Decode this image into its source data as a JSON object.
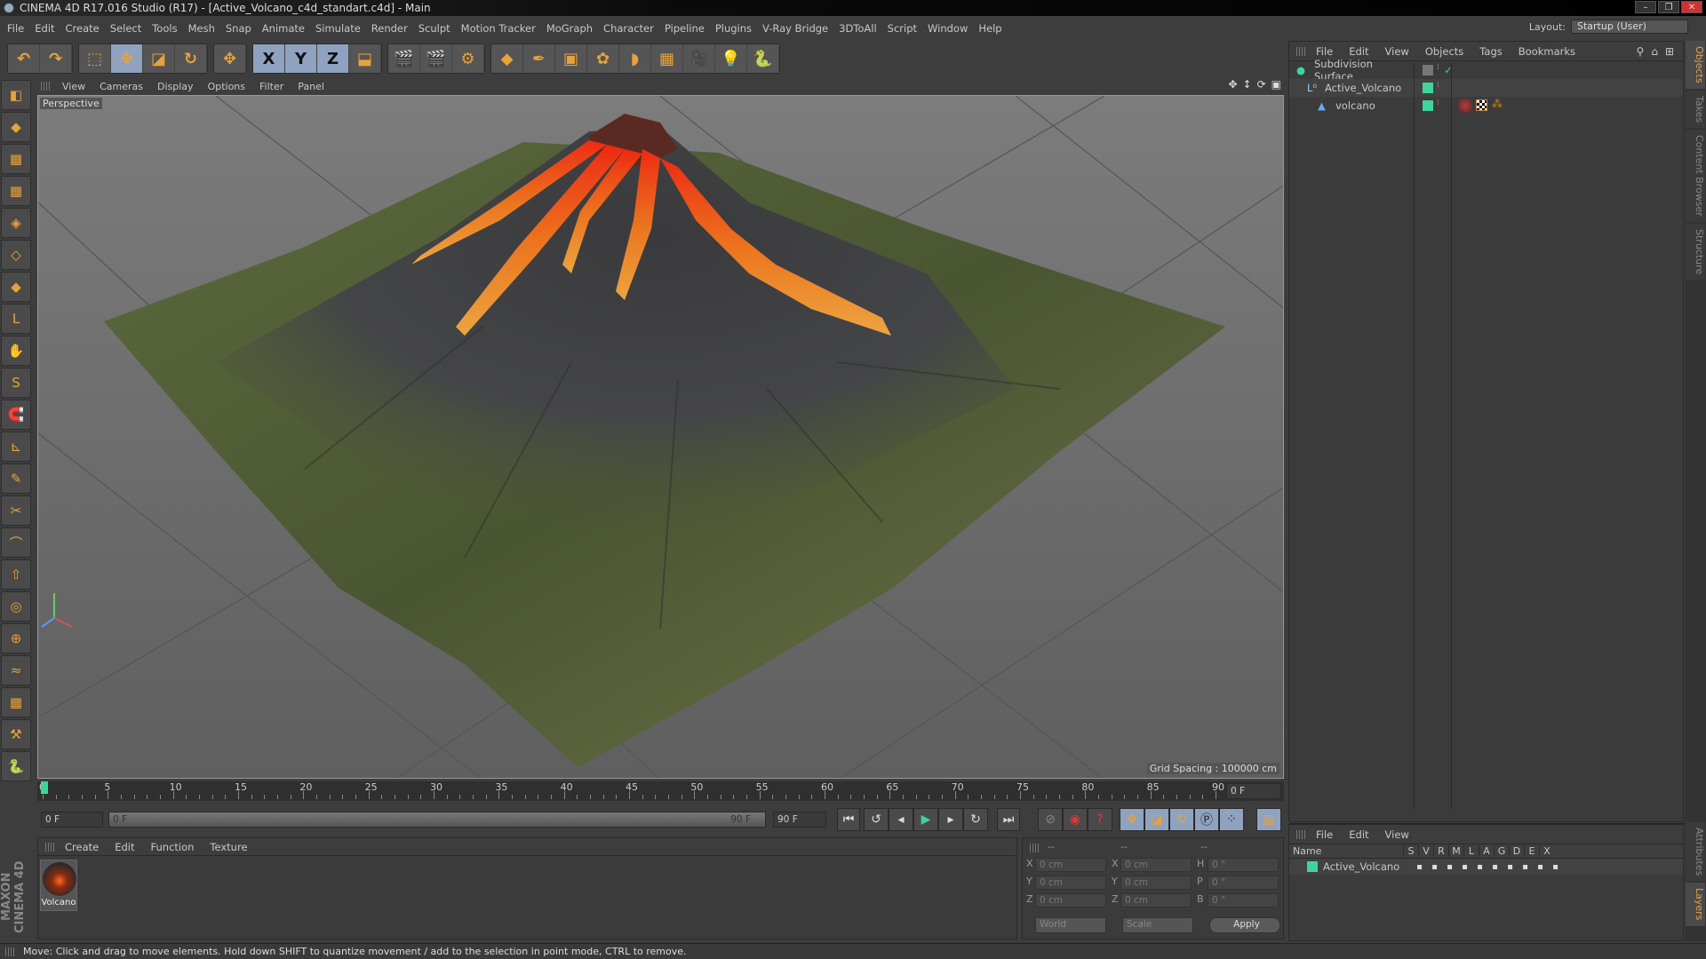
{
  "window": {
    "title": "CINEMA 4D R17.016 Studio (R17) - [Active_Volcano_c4d_standart.c4d] - Main",
    "buttons": [
      "–",
      "❐",
      "✕"
    ]
  },
  "menubar": [
    "File",
    "Edit",
    "Create",
    "Select",
    "Tools",
    "Mesh",
    "Snap",
    "Animate",
    "Simulate",
    "Render",
    "Sculpt",
    "Motion Tracker",
    "MoGraph",
    "Character",
    "Pipeline",
    "Plugins",
    "V-Ray Bridge",
    "3DToAll",
    "Script",
    "Window",
    "Help"
  ],
  "layout": {
    "label": "Layout:",
    "value": "Startup (User)"
  },
  "toolbar": {
    "groups": [
      [
        {
          "icon": "undo-icon",
          "glyph": "↶"
        },
        {
          "icon": "redo-icon",
          "glyph": "↷"
        }
      ],
      [
        {
          "icon": "live-selection-icon",
          "glyph": "⬚"
        },
        {
          "icon": "move-icon",
          "glyph": "✥",
          "on": true
        },
        {
          "icon": "scale-icon",
          "glyph": "◪"
        },
        {
          "icon": "rotate-icon",
          "glyph": "↻"
        }
      ],
      [
        {
          "icon": "last-tool-icon",
          "glyph": "✥"
        }
      ],
      [
        {
          "icon": "x-axis-icon",
          "glyph": "X",
          "on": true
        },
        {
          "icon": "y-axis-icon",
          "glyph": "Y",
          "on": true
        },
        {
          "icon": "z-axis-icon",
          "glyph": "Z",
          "on": true
        },
        {
          "icon": "coordinate-system-icon",
          "glyph": "⬓"
        }
      ],
      [
        {
          "icon": "render-view-icon",
          "glyph": "🎬"
        },
        {
          "icon": "render-picture-viewer-icon",
          "glyph": "🎬"
        },
        {
          "icon": "render-settings-icon",
          "glyph": "⚙"
        }
      ],
      [
        {
          "icon": "cube-icon",
          "glyph": "◆"
        },
        {
          "icon": "pen-spline-icon",
          "glyph": "✒"
        },
        {
          "icon": "subdivision-surface-icon",
          "glyph": "▣"
        },
        {
          "icon": "array-icon",
          "glyph": "✿"
        },
        {
          "icon": "deformer-icon",
          "glyph": "◗"
        },
        {
          "icon": "floor-icon",
          "glyph": "▦"
        },
        {
          "icon": "camera-icon",
          "glyph": "🎥"
        },
        {
          "icon": "light-icon",
          "glyph": "💡"
        },
        {
          "icon": "python-icon",
          "glyph": "🐍"
        }
      ]
    ]
  },
  "lefttools": [
    "make-editable-icon",
    "model-mode-icon",
    "texture-mode-icon",
    "workplane-icon",
    "points-mode-icon",
    "edges-mode-icon",
    "polygons-mode-icon",
    "axis-icon",
    "tweak-icon",
    "snap-icon",
    "magnet-icon",
    "locked-workplane-icon",
    "brush-icon",
    "knife-icon",
    "bridge-icon",
    "extrude-icon",
    "loop-icon",
    "weld-icon",
    "iron-icon",
    "grid-icon",
    "sculpt-icon",
    "python-icon"
  ],
  "viewport": {
    "menu": [
      "View",
      "Cameras",
      "Display",
      "Options",
      "Filter",
      "Panel"
    ],
    "label": "Perspective",
    "grid_spacing": "Grid Spacing : 100000 cm"
  },
  "objects": {
    "menu": [
      "File",
      "Edit",
      "View",
      "Objects",
      "Tags",
      "Bookmarks"
    ],
    "rows": [
      {
        "name": "Subdivision Surface",
        "icon": "subdivision-surface-icon",
        "indent": 0
      },
      {
        "name": "Active_Volcano",
        "icon": "null-object-icon",
        "indent": 1
      },
      {
        "name": "volcano",
        "icon": "polygon-object-icon",
        "indent": 2
      }
    ]
  },
  "right_tabs_top": [
    "Objects",
    "Takes",
    "Content Browser",
    "Structure"
  ],
  "right_tabs_bottom": [
    "Attributes",
    "Layers"
  ],
  "timeline": {
    "ticks": [
      0,
      5,
      10,
      15,
      20,
      25,
      30,
      35,
      40,
      45,
      50,
      55,
      60,
      65,
      70,
      75,
      80,
      85,
      90
    ],
    "current": "0 F",
    "start": "0 F",
    "range_start": "0 F",
    "range_end": "90 F",
    "end": "90 F"
  },
  "materials": {
    "menu": [
      "Create",
      "Edit",
      "Function",
      "Texture"
    ],
    "items": [
      {
        "name": "Volcano"
      }
    ]
  },
  "coords": {
    "headers": [
      "--",
      "--",
      "--"
    ],
    "rows": [
      {
        "a": "X",
        "av": "0 cm",
        "b": "X",
        "bv": "0 cm",
        "c": "H",
        "cv": "0 °"
      },
      {
        "a": "Y",
        "av": "0 cm",
        "b": "Y",
        "bv": "0 cm",
        "c": "P",
        "cv": "0 °"
      },
      {
        "a": "Z",
        "av": "0 cm",
        "b": "Z",
        "bv": "0 cm",
        "c": "B",
        "cv": "0 °"
      }
    ],
    "mode": "World",
    "scale": "Scale",
    "apply": "Apply"
  },
  "layers": {
    "menu": [
      "File",
      "Edit",
      "View"
    ],
    "columns": [
      "Name",
      "S",
      "V",
      "R",
      "M",
      "L",
      "A",
      "G",
      "D",
      "E",
      "X"
    ],
    "rows": [
      {
        "name": "Active_Volcano"
      }
    ]
  },
  "brand": "MAXON CINEMA 4D",
  "status": "Move: Click and drag to move elements. Hold down SHIFT to quantize movement / add to the selection in point mode, CTRL to remove.",
  "colors": {
    "layer_green": "#3fd59a",
    "active_tab": "#e6a44a",
    "lava": "#ff5a1a"
  }
}
